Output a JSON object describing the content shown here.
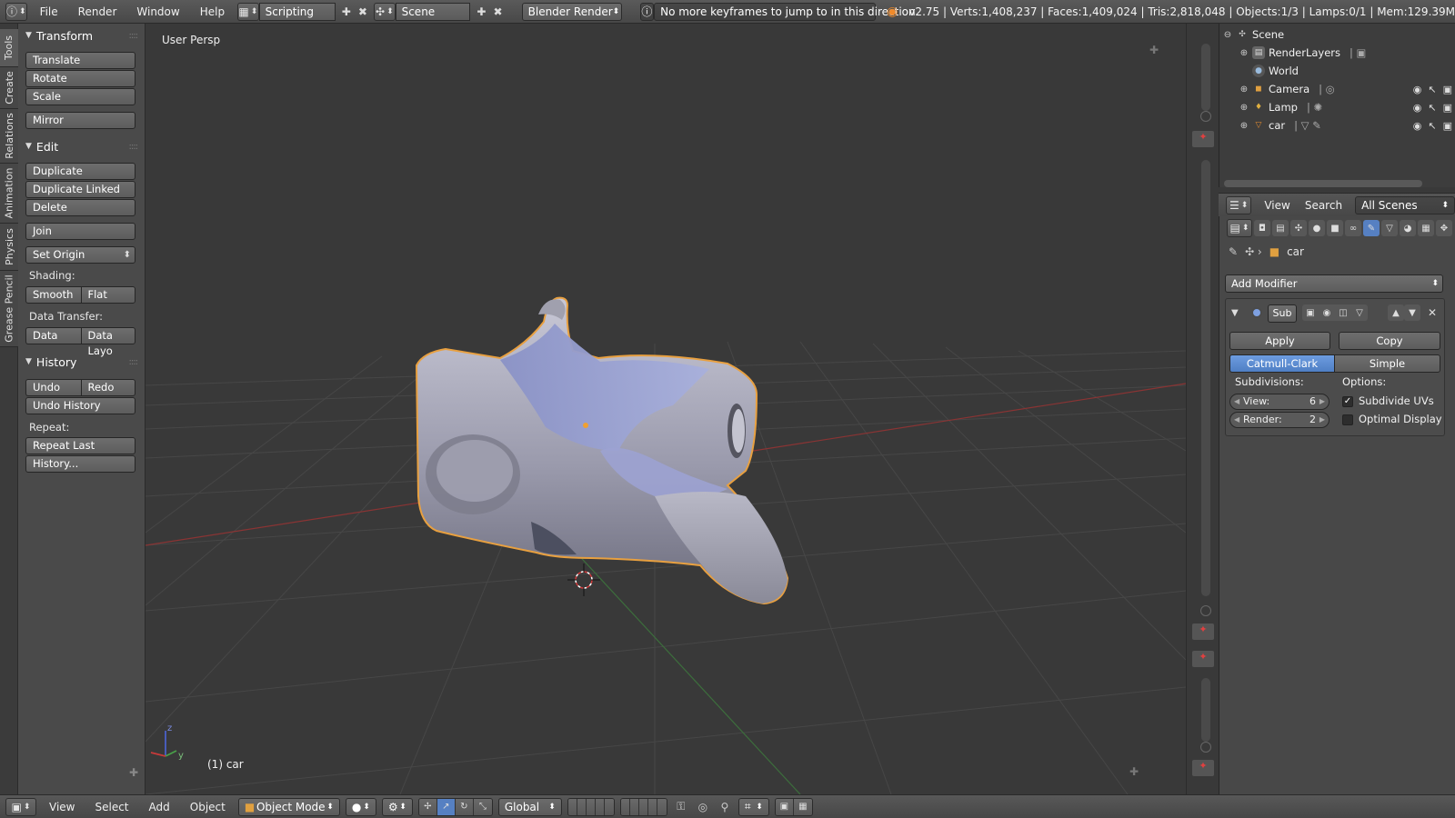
{
  "topbar": {
    "menus": [
      "File",
      "Render",
      "Window",
      "Help"
    ],
    "layout": "Scripting",
    "scene": "Scene",
    "engine": "Blender Render",
    "report": "No more keyframes to jump to in this direction",
    "stats": "v2.75 | Verts:1,408,237 | Faces:1,409,024 | Tris:2,818,048 | Objects:1/3 | Lamps:0/1 | Mem:129.39M"
  },
  "tabs": [
    "Tools",
    "Create",
    "Relations",
    "Animation",
    "Physics",
    "Grease Pencil"
  ],
  "toolshelf": {
    "transform": {
      "title": "Transform",
      "buttons": [
        "Translate",
        "Rotate",
        "Scale",
        "Mirror"
      ]
    },
    "edit": {
      "title": "Edit",
      "buttons": [
        "Duplicate",
        "Duplicate Linked",
        "Delete",
        "Join"
      ],
      "set_origin": "Set Origin",
      "shading_label": "Shading:",
      "smooth": "Smooth",
      "flat": "Flat",
      "data_transfer_label": "Data Transfer:",
      "data": "Data",
      "data_layout": "Data Layo"
    },
    "history": {
      "title": "History",
      "undo": "Undo",
      "redo": "Redo",
      "undo_history": "Undo History",
      "repeat_label": "Repeat:",
      "repeat_last": "Repeat Last",
      "history_btn": "History..."
    }
  },
  "viewport": {
    "view_name": "User Persp",
    "object_label": "(1) car",
    "axis_z": "z",
    "axis_y": "y"
  },
  "outliner": {
    "items": [
      {
        "name": "Scene"
      },
      {
        "name": "RenderLayers"
      },
      {
        "name": "World"
      },
      {
        "name": "Camera"
      },
      {
        "name": "Lamp"
      },
      {
        "name": "car"
      }
    ]
  },
  "props_header": {
    "view": "View",
    "search": "Search",
    "scenes": "All Scenes"
  },
  "properties": {
    "object": "car",
    "add_modifier": "Add Modifier",
    "modifier_name": "Sub",
    "apply": "Apply",
    "copy": "Copy",
    "catmull": "Catmull-Clark",
    "simple": "Simple",
    "subdivisions_label": "Subdivisions:",
    "options_label": "Options:",
    "view_label": "View:",
    "view_value": "6",
    "render_label": "Render:",
    "render_value": "2",
    "subdivide_uvs": "Subdivide UVs",
    "optimal_display": "Optimal Display",
    "subdivide_uvs_checked": true,
    "optimal_display_checked": false
  },
  "bottombar": {
    "menus": [
      "View",
      "Select",
      "Add",
      "Object"
    ],
    "mode": "Object Mode",
    "orientation": "Global"
  },
  "colors": {
    "selection_outline": "#e8a040",
    "active_blue": "#5680c2",
    "x_axis": "#b03838",
    "y_axis": "#3e8a3e"
  }
}
